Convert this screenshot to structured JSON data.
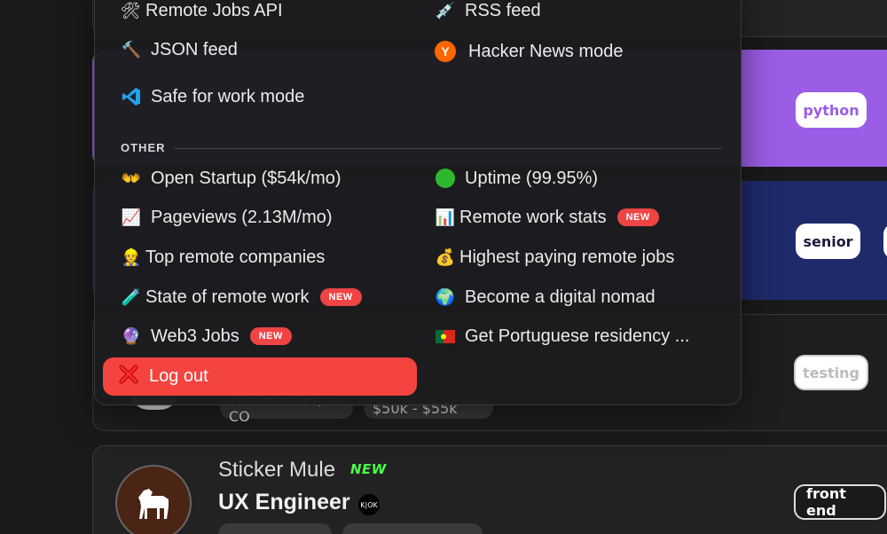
{
  "menu": {
    "items_left": [
      {
        "label": "Remote Jobs API",
        "icon": "tools-icon"
      },
      {
        "label": "JSON feed",
        "icon": "hammer-icon"
      },
      {
        "label": "Safe for work mode",
        "icon": "vscode-icon"
      }
    ],
    "items_right": [
      {
        "label": "RSS feed",
        "icon": "syringe-icon"
      },
      {
        "label": "Hacker News mode",
        "icon": "hacker-news-icon",
        "glyph": "Y"
      }
    ],
    "section_other": "OTHER",
    "other_left": [
      {
        "label": "Open Startup ($54k/mo)",
        "icon": "open-hands-icon"
      },
      {
        "label": "Pageviews (2.13M/mo)",
        "icon": "chart-increasing-icon"
      },
      {
        "label": "Top remote companies",
        "icon": "construction-worker-icon"
      },
      {
        "label": "State of remote work",
        "icon": "test-tube-icon",
        "badge": "NEW"
      },
      {
        "label": "Web3 Jobs",
        "icon": "crystal-ball-icon",
        "badge": "NEW"
      }
    ],
    "other_right": [
      {
        "label": "Uptime (99.95%)",
        "icon": "green-circle-icon"
      },
      {
        "label": "Remote work stats",
        "icon": "bar-chart-icon",
        "badge": "NEW"
      },
      {
        "label": "Highest paying remote jobs",
        "icon": "money-bag-icon"
      },
      {
        "label": "Become a digital nomad",
        "icon": "globe-icon"
      },
      {
        "label": "Get Portuguese residency ...",
        "icon": "portugal-flag-icon"
      }
    ],
    "logout_label": "Log out"
  },
  "jobs": {
    "tags": [
      "python",
      "senior",
      "testing",
      "front end"
    ],
    "location_partial": "Westminster, CO",
    "salary_partial": "$50k - $55k",
    "job": {
      "company": "Sticker Mule",
      "company_badge": "NEW",
      "position": "UX Engineer",
      "verified_glyph": "K|OK"
    }
  },
  "colors": {
    "logout": "#f5433f",
    "new_pill": "#ef4444",
    "python_card": "#9b5de5",
    "senior_card": "#1f2a6b"
  }
}
